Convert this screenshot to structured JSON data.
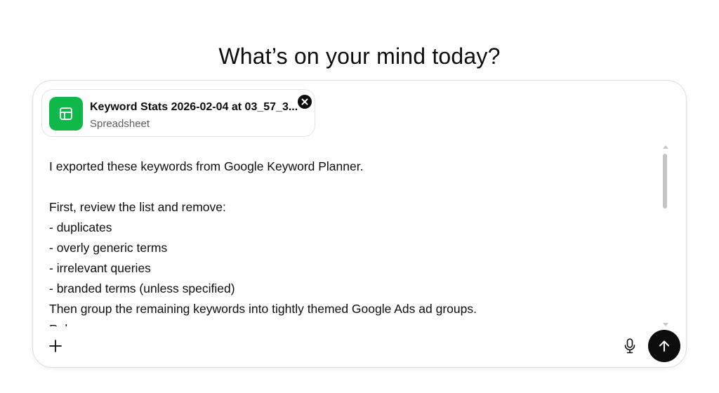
{
  "heading": "What’s on your mind today?",
  "attachment": {
    "file_name": "Keyword Stats 2026-02-04 at 03_57_3...",
    "file_type": "Spreadsheet",
    "icon": "spreadsheet-icon",
    "icon_color": "#10b84a",
    "remove_icon": "close-icon"
  },
  "prompt": {
    "lines": [
      "I exported these keywords from Google Keyword Planner.",
      "",
      "First, review the list and remove:",
      "- duplicates",
      "- overly generic terms",
      "- irrelevant queries",
      "- branded terms (unless specified)",
      "Then group the remaining keywords into tightly themed Google Ads ad groups.",
      "Rules:"
    ]
  },
  "toolbar": {
    "add_icon": "plus-icon",
    "mic_icon": "microphone-icon",
    "send_icon": "arrow-up-icon",
    "send_color": "#0d0d0d"
  }
}
